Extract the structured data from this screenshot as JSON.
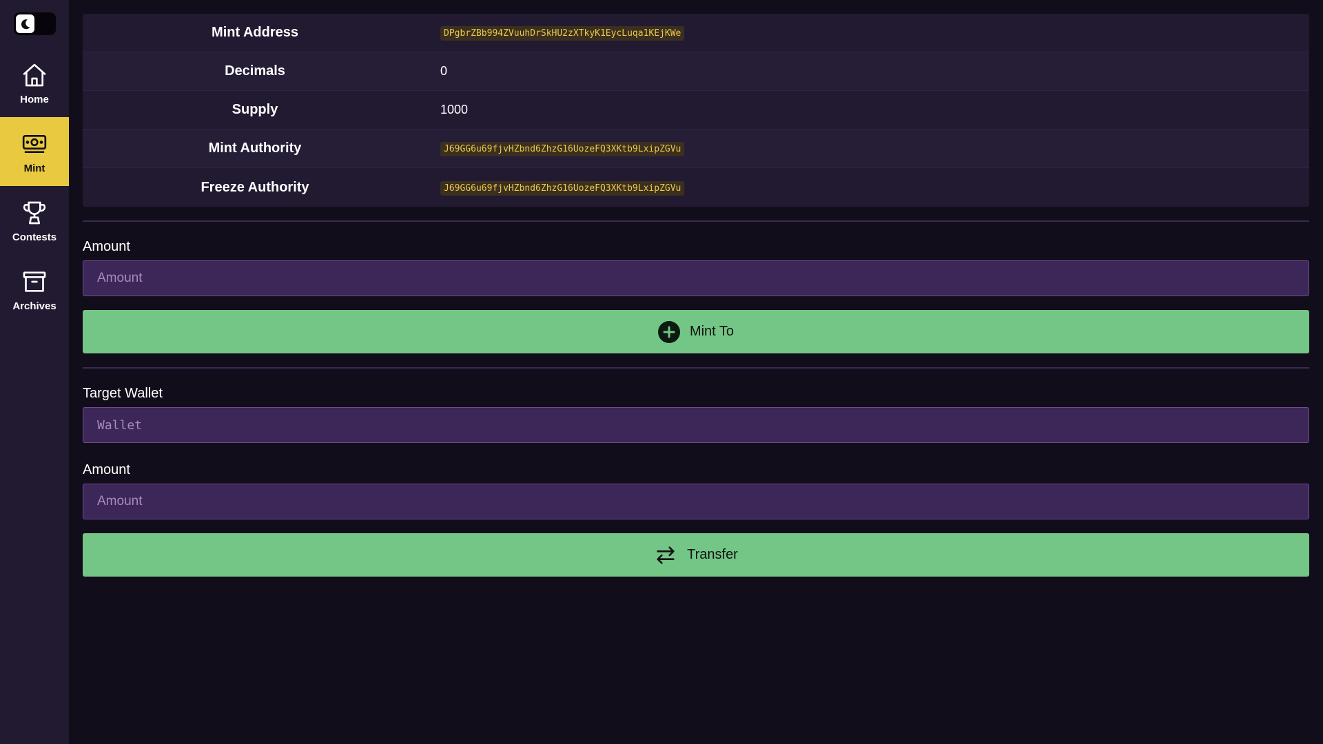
{
  "sidebar": {
    "theme_toggle_icon": "moon-icon",
    "items": [
      {
        "label": "Home",
        "icon": "home-icon",
        "active": false
      },
      {
        "label": "Mint",
        "icon": "money-icon",
        "active": true
      },
      {
        "label": "Contests",
        "icon": "trophy-icon",
        "active": false
      },
      {
        "label": "Archives",
        "icon": "archive-box-icon",
        "active": false
      }
    ]
  },
  "mint_info": {
    "rows": [
      {
        "label": "Mint Address",
        "value": "DPgbrZBb994ZVuuhDrSkHU2zXTkyK1EycLuqa1KEjKWe",
        "is_code": true
      },
      {
        "label": "Decimals",
        "value": "0",
        "is_code": false
      },
      {
        "label": "Supply",
        "value": "1000",
        "is_code": false
      },
      {
        "label": "Mint Authority",
        "value": "J69GG6u69fjvHZbnd6ZhzG16UozeFQ3XKtb9LxipZGVu",
        "is_code": true
      },
      {
        "label": "Freeze Authority",
        "value": "J69GG6u69fjvHZbnd6ZhzG16UozeFQ3XKtb9LxipZGVu",
        "is_code": true
      }
    ]
  },
  "mint_form": {
    "amount_label": "Amount",
    "amount_placeholder": "Amount",
    "amount_value": "",
    "button_label": "Mint To",
    "button_icon": "plus-circle-icon"
  },
  "transfer_form": {
    "wallet_label": "Target Wallet",
    "wallet_placeholder": "Wallet",
    "wallet_value": "",
    "amount_label": "Amount",
    "amount_placeholder": "Amount",
    "amount_value": "",
    "button_label": "Transfer",
    "button_icon": "arrows-exchange-icon"
  },
  "colors": {
    "background": "#120d1a",
    "sidebar": "#221a31",
    "active_nav": "#e9c940",
    "button": "#73c685",
    "input": "#3d2658",
    "code_text": "#ecc94b"
  }
}
